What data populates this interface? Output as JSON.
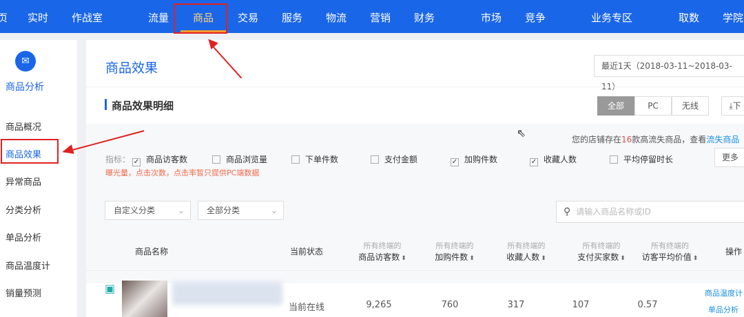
{
  "nav": [
    "页",
    "实时",
    "作战室",
    "流量",
    "商品",
    "交易",
    "服务",
    "物流",
    "营销",
    "财务",
    "市场",
    "竞争",
    "业务专区",
    "取数",
    "学院"
  ],
  "sidebar": {
    "title": "商品分析",
    "items": [
      "商品概况",
      "商品效果",
      "异常商品",
      "分类分析",
      "单品分析",
      "商品温度计",
      "销量预测"
    ]
  },
  "page_title": "商品效果",
  "date_range": "最近1天（2018-03-11~2018-03-11）",
  "section_title": "商品效果明细",
  "device_tabs": [
    "全部",
    "PC",
    "无线"
  ],
  "download_label": "下",
  "notice": {
    "prefix": "您的店铺存在",
    "count": "16",
    "suffix": "款高流失商品，查看",
    "link": "流失商品"
  },
  "metrics_label": "指标：",
  "metrics": [
    {
      "label": "商品访客数",
      "checked": true
    },
    {
      "label": "商品浏览量",
      "checked": false
    },
    {
      "label": "下单件数",
      "checked": false
    },
    {
      "label": "支付金额",
      "checked": false
    },
    {
      "label": "加购件数",
      "checked": true
    },
    {
      "label": "收藏人数",
      "checked": true
    },
    {
      "label": "平均停留时长",
      "checked": false
    }
  ],
  "more_label": "更多",
  "warning": "曝光量，点击次数，点击率暂只提供PC端数据",
  "filters": [
    "自定义分类",
    "全部分类"
  ],
  "search_placeholder": "请输入商品名称或ID",
  "table": {
    "headers": [
      {
        "top": "",
        "main": "商品名称"
      },
      {
        "top": "",
        "main": "当前状态"
      },
      {
        "top": "所有终端的",
        "main": "商品访客数"
      },
      {
        "top": "所有终端的",
        "main": "加购件数"
      },
      {
        "top": "所有终端的",
        "main": "收藏人数"
      },
      {
        "top": "所有终端的",
        "main": "支付买家数"
      },
      {
        "top": "所有终端的",
        "main": "访客平均价值"
      },
      {
        "top": "",
        "main": "操作"
      }
    ],
    "rows": [
      {
        "status": "当前在线",
        "visitors": "9,265",
        "cart": "760",
        "fav": "317",
        "buyers": "107",
        "avg_value": "0.57",
        "actions": [
          "商品温度计",
          "单品分析"
        ]
      }
    ]
  },
  "colors": {
    "brand": "#1a66e8",
    "highlight": "#e02020"
  }
}
